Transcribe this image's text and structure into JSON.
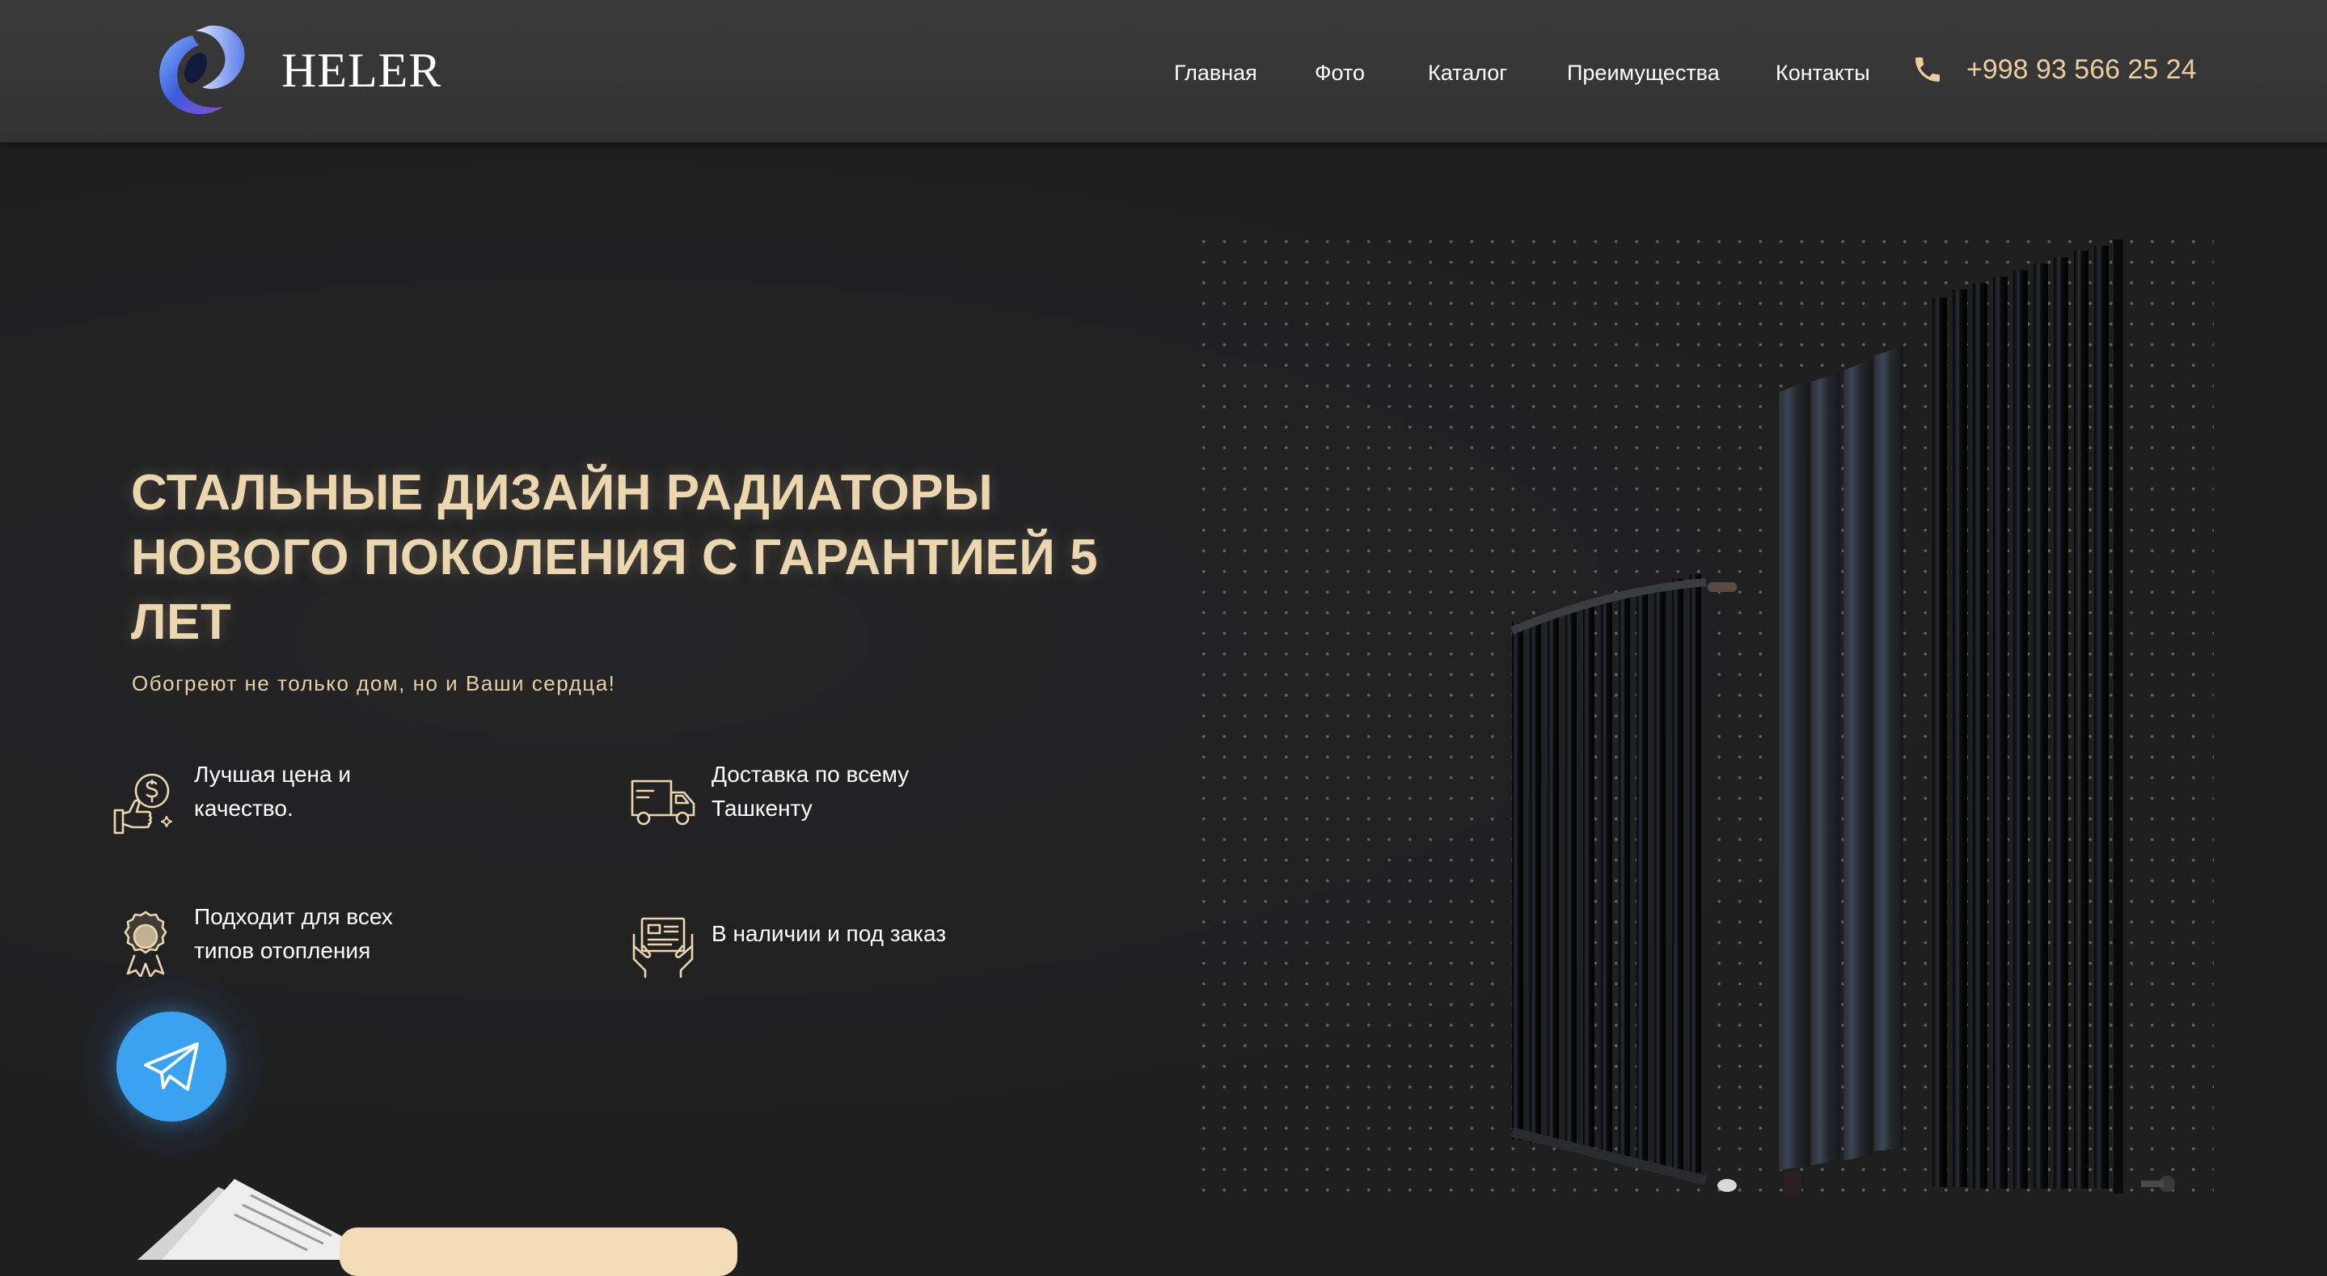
{
  "header": {
    "logo_text": "HELER",
    "nav": [
      "Главная",
      "Фото",
      "Каталог",
      "Преимущества",
      "Контакты"
    ],
    "phone": "+998 93 566 25 24"
  },
  "hero": {
    "title": "СТАЛЬНЫЕ ДИЗАЙН РАДИАТОРЫ НОВОГО ПОКОЛЕНИЯ С ГАРАНТИЕЙ 5 ЛЕТ",
    "subtitle": "Обогреют не только дом, но и Ваши сердца!",
    "features": [
      {
        "icon": "price-quality-icon",
        "text": "Лучшая цена и качество."
      },
      {
        "icon": "delivery-truck-icon",
        "text": "Доставка по всему Ташкенту"
      },
      {
        "icon": "award-icon",
        "text": "Подходит для всех типов отопления"
      },
      {
        "icon": "catalog-order-icon",
        "text": "В наличии и под заказ"
      }
    ]
  },
  "colors": {
    "accent": "#ecd6b0",
    "phone": "#ebcd9d",
    "background": "#1f1f20",
    "header": "#363637",
    "telegram": "#3aa2f0"
  }
}
